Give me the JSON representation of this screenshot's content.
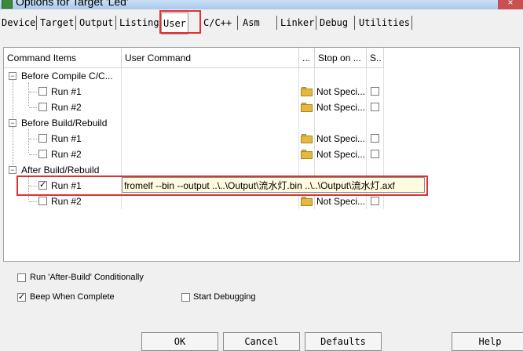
{
  "window": {
    "title": "Options for Target 'Led'",
    "close_glyph": "×"
  },
  "tabs": [
    "Device",
    "Target",
    "Output",
    "Listing",
    "User",
    "C/C++",
    "Asm",
    "Linker",
    "Debug",
    "Utilities"
  ],
  "active_tab": "User",
  "table": {
    "headers": [
      "Command Items",
      "User Command",
      "...",
      "Stop on ...",
      "S.."
    ],
    "groups": [
      {
        "label": "Before Compile C/C...",
        "rows": [
          {
            "label": "Run #1",
            "checked": false,
            "stop": "Not Speci..."
          },
          {
            "label": "Run #2",
            "checked": false,
            "stop": "Not Speci..."
          }
        ]
      },
      {
        "label": "Before Build/Rebuild",
        "rows": [
          {
            "label": "Run #1",
            "checked": false,
            "stop": "Not Speci..."
          },
          {
            "label": "Run #2",
            "checked": false,
            "stop": "Not Speci..."
          }
        ]
      },
      {
        "label": "After Build/Rebuild",
        "rows": [
          {
            "label": "Run #1",
            "checked": true,
            "command": "fromelf --bin --output ..\\..\\Output\\流水灯.bin ..\\..\\Output\\流水灯.axf"
          },
          {
            "label": "Run #2",
            "checked": false,
            "stop": "Not Speci..."
          }
        ]
      }
    ],
    "check_glyph": "✓",
    "tree_glyph": "−"
  },
  "options": {
    "run_after_build": "Run 'After-Build' Conditionally",
    "beep_when_complete": "Beep When Complete",
    "start_debugging": "Start Debugging"
  },
  "buttons": {
    "ok": "OK",
    "cancel": "Cancel",
    "defaults": "Defaults",
    "help": "Help"
  }
}
